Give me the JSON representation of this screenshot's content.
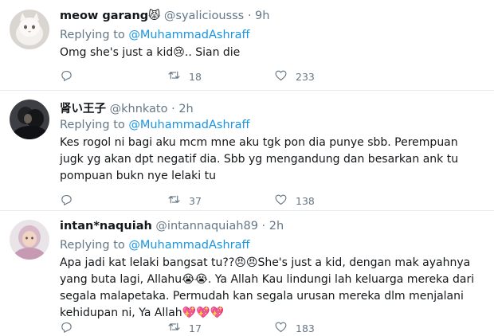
{
  "tweets": [
    {
      "name": "meow garang😾",
      "handle": "@syaliciousss",
      "separator": "·",
      "time": "9h",
      "replying_to_label": "Replying to ",
      "mention": "@MuhammadAshraff",
      "text": "Omg she's just a kid😢.. Sian die",
      "reply_count": "",
      "retweet_count": "18",
      "like_count": "233"
    },
    {
      "name": "肾い王子",
      "handle": "@khnkato",
      "separator": "·",
      "time": "2h",
      "replying_to_label": "Replying to ",
      "mention": "@MuhammadAshraff",
      "text": "Kes rogol ni bagi aku mcm mne aku tgk pon dia punye sbb. Perempuan jugk yg akan dpt negatif dia. Sbb yg mengandung dan besarkan ank tu pompuan bukn nye lelaki tu",
      "reply_count": "",
      "retweet_count": "37",
      "like_count": "138"
    },
    {
      "name": "intan*naquiah",
      "handle": "@intannaquiah89",
      "separator": "·",
      "time": "2h",
      "replying_to_label": "Replying to ",
      "mention": "@MuhammadAshraff",
      "text": "Apa jadi kat lelaki bangsat tu??😠😠She's just a kid, dengan mak ayahnya yang buta lagi, Allahu😭😭. Ya Allah Kau lindungi lah keluarga  mereka dari segala malapetaka. Permudah kan segala urusan mereka dlm menjalani kehidupan ni, Ya Allah💖💖💖",
      "reply_count": "",
      "retweet_count": "17",
      "like_count": "183"
    }
  ],
  "icons": [
    "reply-icon",
    "retweet-icon",
    "like-icon"
  ],
  "colors": {
    "text": "#14171a",
    "secondary": "#657786",
    "link": "#1b95e0",
    "divider": "#e6ecf0"
  }
}
